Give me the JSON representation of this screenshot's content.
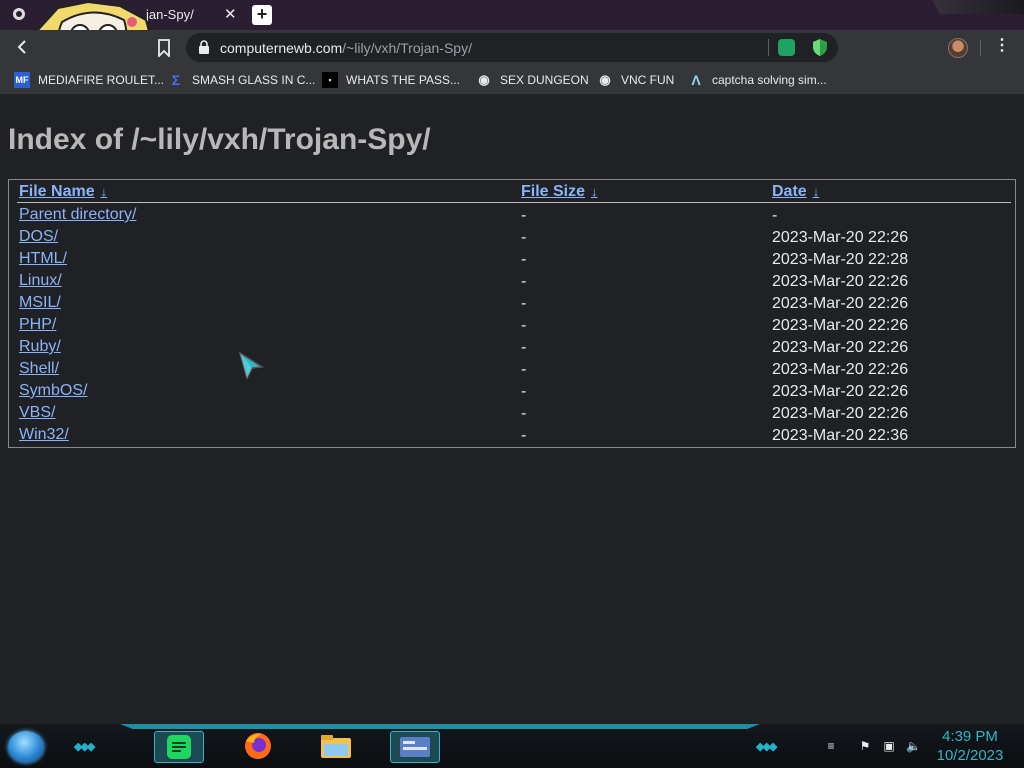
{
  "browser": {
    "tab_title": "jan-Spy/",
    "tab_close": "✕",
    "new_tab": "+",
    "url_host": "computernewb.com",
    "url_path": "/~lily/vxh/Trojan-Spy/",
    "menu_glyph": "⋮"
  },
  "bookmarks": [
    {
      "label": "MEDIAFIRE ROULET...",
      "icon": "mediafire-icon",
      "badge": "MF"
    },
    {
      "label": "SMASH GLASS IN C...",
      "icon": "bracket-logo-icon",
      "badge": "Σ"
    },
    {
      "label": "WHATS THE PASS...",
      "icon": "black-square-icon",
      "badge": "▪"
    },
    {
      "label": "SEX DUNGEON",
      "icon": "bot-icon",
      "badge": "◉"
    },
    {
      "label": "VNC FUN",
      "icon": "bot-icon",
      "badge": "◉"
    },
    {
      "label": "captcha solving sim...",
      "icon": "lambda-icon",
      "badge": "Λ"
    }
  ],
  "page": {
    "title": "Index of /~lily/vxh/Trojan-Spy/",
    "columns": [
      {
        "label": "File Name",
        "sort_glyph": "↓"
      },
      {
        "label": "File Size",
        "sort_glyph": "↓"
      },
      {
        "label": "Date",
        "sort_glyph": "↓"
      }
    ],
    "rows": [
      {
        "name": "Parent directory/",
        "size": "-",
        "date": "-"
      },
      {
        "name": "DOS/",
        "size": "-",
        "date": "2023-Mar-20 22:26"
      },
      {
        "name": "HTML/",
        "size": "-",
        "date": "2023-Mar-20 22:28"
      },
      {
        "name": "Linux/",
        "size": "-",
        "date": "2023-Mar-20 22:26"
      },
      {
        "name": "MSIL/",
        "size": "-",
        "date": "2023-Mar-20 22:26"
      },
      {
        "name": "PHP/",
        "size": "-",
        "date": "2023-Mar-20 22:26"
      },
      {
        "name": "Ruby/",
        "size": "-",
        "date": "2023-Mar-20 22:26"
      },
      {
        "name": "Shell/",
        "size": "-",
        "date": "2023-Mar-20 22:26"
      },
      {
        "name": "SymbOS/",
        "size": "-",
        "date": "2023-Mar-20 22:26"
      },
      {
        "name": "VBS/",
        "size": "-",
        "date": "2023-Mar-20 22:26"
      },
      {
        "name": "Win32/",
        "size": "-",
        "date": "2023-Mar-20 22:36"
      }
    ]
  },
  "taskbar": {
    "time": "4:39 PM",
    "date": "10/2/2023",
    "apps": [
      "notes-app-icon",
      "firefox-icon",
      "file-explorer-icon",
      "control-panel-icon"
    ]
  },
  "colors": {
    "link": "#8ab4f8",
    "heading": "#b8b8b8",
    "accent": "#2fb7c9"
  }
}
